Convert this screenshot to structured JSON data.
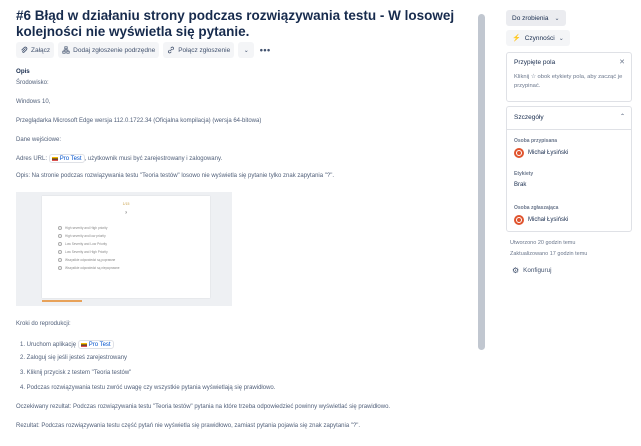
{
  "issue": {
    "title": "#6 Błąd w działaniu strony podczas rozwiązywania testu - W losowej kolejności nie wyświetla się pytanie."
  },
  "toolbar": {
    "attach_label": "Załącz",
    "add_subtask_label": "Dodaj zgłoszenie podrzędne",
    "link_issue_label": "Połącz zgłoszenie"
  },
  "description": {
    "heading": "Opis",
    "environment": "Środowisko:",
    "os": "Windows 10,",
    "browser": "Przeglądarka Microsoft Edge wersja 112.0.1722.34 (Oficjalna kompilacja) (wersja 64-bitowa)",
    "input_data": "Dane wejściowe:",
    "url_prefix": "Adres URL:",
    "url_chip": "Pro Test",
    "url_suffix": ", użytkownik musi być zarejestrowany i zalogowany.",
    "summary": "Opis: Na stronie podczas rozwiązywania testu \"Teoria testów\" losowo nie wyświetla się pytanie tylko znak zapytania \"?\".",
    "steps_heading": "Kroki do reprodukcji:",
    "steps": [
      "Uruchom aplikację",
      "Zaloguj się jeśli jesteś zarejestrowany",
      "Kliknij przycisk z testem \"Teoria testów\"",
      "Podczas rozwiązywania testu zwróć uwagę czy wszystkie pytania wyświetlają się prawidłowo."
    ],
    "step1_chip": "Pro Test",
    "expected": "Oczekiwany rezultat: Podczas rozwiązywania testu \"Teoria testów\" pytania na które trzeba odpowiedzieć powinny wyświetlać się prawidłowo.",
    "actual": "Rezultat: Podczas rozwiązywania testu część pytań nie wyświetla się prawidłowo, zamiast pytania pojawia się znak zapytania \"?\"."
  },
  "screenshot_thumb": {
    "header": "1/15",
    "question": "?",
    "options": [
      "High severity and High priority",
      "High severity and low priority",
      "Low Severity and Low Priority",
      "Low Severity and High Priority",
      "Wszystkie odpowiedzi są poprawne",
      "Wszystkie odpowiedzi są niepoprawne"
    ]
  },
  "sidebar": {
    "status_label": "Do zrobienia",
    "actions_label": "Czynności",
    "pinned": {
      "heading": "Przypięte pola",
      "hint": "Kliknij ☆ obok etykiety pola, aby zacząć je przypinać."
    },
    "details": {
      "heading": "Szczegóły",
      "assignee_label": "Osoba przypisana",
      "assignee_value": "Michał Łysiński",
      "labels_label": "Etykiety",
      "labels_value": "Brak",
      "reporter_label": "Osoba zgłaszająca",
      "reporter_value": "Michał Łysiński"
    },
    "created": "Utworzono 20 godzin temu",
    "updated": "Zaktualizowano 17 godzin temu",
    "configure_label": "Konfiguruj"
  },
  "colors": {
    "avatar": "#e0542e",
    "link": "#0052cc",
    "status_bg": "#ebecf0"
  }
}
